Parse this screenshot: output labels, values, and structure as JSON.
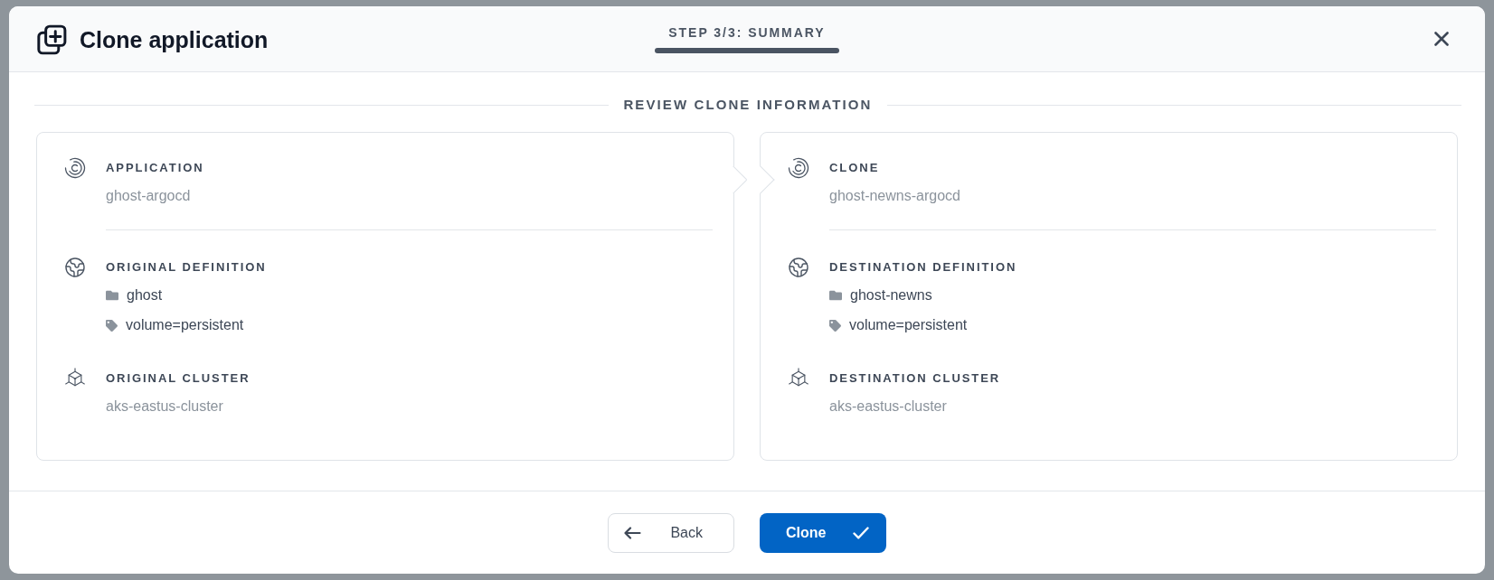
{
  "dialog": {
    "title": "Clone application",
    "step": {
      "label": "STEP 3/3: SUMMARY"
    }
  },
  "review": {
    "title": "REVIEW CLONE INFORMATION"
  },
  "panels": [
    {
      "sections": [
        {
          "kind": "application",
          "label": "APPLICATION",
          "value": "ghost-argocd"
        },
        {
          "kind": "definition",
          "label": "ORIGINAL DEFINITION",
          "items": [
            {
              "kind": "namespace",
              "text": "ghost"
            },
            {
              "kind": "label",
              "text": "volume=persistent"
            }
          ]
        },
        {
          "kind": "cluster",
          "label": "ORIGINAL CLUSTER",
          "value": "aks-eastus-cluster"
        }
      ]
    },
    {
      "sections": [
        {
          "kind": "application",
          "label": "CLONE",
          "value": "ghost-newns-argocd"
        },
        {
          "kind": "definition",
          "label": "DESTINATION DEFINITION",
          "items": [
            {
              "kind": "namespace",
              "text": "ghost-newns"
            },
            {
              "kind": "label",
              "text": "volume=persistent"
            }
          ]
        },
        {
          "kind": "cluster",
          "label": "DESTINATION CLUSTER",
          "value": "aks-eastus-cluster"
        }
      ]
    }
  ],
  "buttons": [
    {
      "kind": "back",
      "label": "Back"
    },
    {
      "kind": "primary",
      "label": "Clone"
    }
  ]
}
